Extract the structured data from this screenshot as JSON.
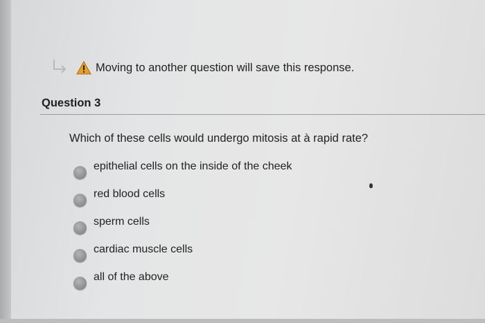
{
  "notice": {
    "text": "Moving to another question will save this response.",
    "arrow_icon": "return-arrow-icon",
    "warning_icon": "warning-icon",
    "warning_color": "#e8a020"
  },
  "question": {
    "title": "Question 3",
    "prompt": "Which of these cells would undergo mitosis at à rapid rate?",
    "options": [
      {
        "label": "epithelial cells on the inside of the cheek",
        "selected": false
      },
      {
        "label": "red blood cells",
        "selected": false
      },
      {
        "label": "sperm cells",
        "selected": false
      },
      {
        "label": "cardiac muscle cells",
        "selected": false
      },
      {
        "label": "all of the above",
        "selected": false
      }
    ]
  }
}
